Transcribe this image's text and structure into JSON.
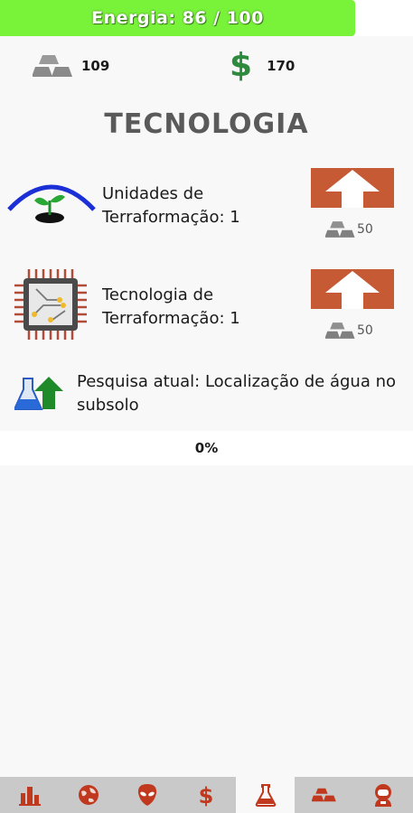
{
  "energy": {
    "text": "Energia: 86 / 100",
    "current": 86,
    "max": 100
  },
  "resources": {
    "metal": {
      "icon": "metal-bars-icon",
      "value": "109"
    },
    "money": {
      "icon": "dollar-icon",
      "symbol": "$",
      "value": "170"
    }
  },
  "section_title": "TECNOLOGIA",
  "techs": [
    {
      "icon": "plant-dome-icon",
      "label": "Unidades de Terraformação: 1",
      "button_icon": "arrow-up-icon",
      "cost": "50",
      "cost_icon": "metal-bars-icon"
    },
    {
      "icon": "chip-icon",
      "label": "Tecnologia de Terraformação: 1",
      "button_icon": "arrow-up-icon",
      "cost": "50",
      "cost_icon": "metal-bars-icon"
    }
  ],
  "research": {
    "icon": "flask-arrow-icon",
    "text": "Pesquisa atual: Localização de água no subsolo",
    "progress_text": "0%",
    "progress": 0
  },
  "nav": [
    {
      "name": "stats",
      "icon": "bar-chart-icon"
    },
    {
      "name": "planet",
      "icon": "planet-icon"
    },
    {
      "name": "alien",
      "icon": "alien-icon"
    },
    {
      "name": "money",
      "icon": "dollar-icon"
    },
    {
      "name": "tech",
      "icon": "flask-icon",
      "active": true
    },
    {
      "name": "metal",
      "icon": "metal-bars-icon"
    },
    {
      "name": "astronaut",
      "icon": "astronaut-icon"
    }
  ],
  "colors": {
    "energy": "#79f23a",
    "accent": "#c55a34",
    "money": "#2e8b3d",
    "nav_icon": "#c0391f"
  }
}
